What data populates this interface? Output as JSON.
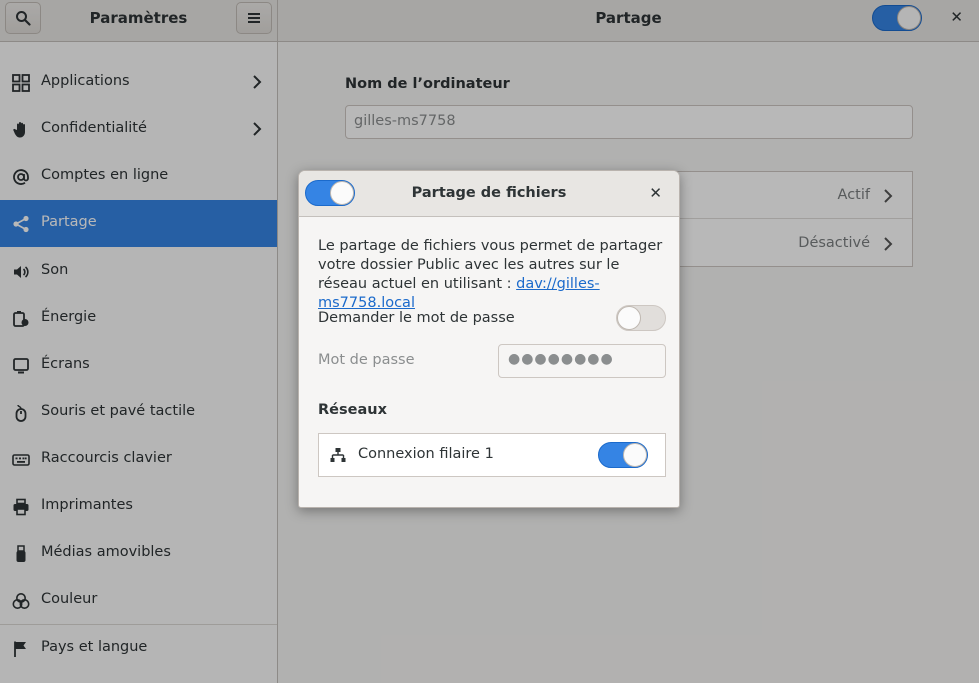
{
  "window": {
    "left_title": "Paramètres",
    "right_title": "Partage",
    "close_glyph": "✕"
  },
  "sidebar": {
    "items": [
      {
        "label": "Applications",
        "icon": "applications-icon",
        "chevron": true
      },
      {
        "label": "Confidentialité",
        "icon": "hand-icon",
        "chevron": true
      },
      {
        "label": "Comptes en ligne",
        "icon": "at-icon",
        "chevron": false
      },
      {
        "label": "Partage",
        "icon": "share-icon",
        "chevron": false,
        "selected": true
      },
      {
        "label": "Son",
        "icon": "speaker-icon",
        "chevron": false
      },
      {
        "label": "Énergie",
        "icon": "power-icon",
        "chevron": false
      },
      {
        "label": "Écrans",
        "icon": "display-icon",
        "chevron": false
      },
      {
        "label": "Souris et pavé tactile",
        "icon": "mouse-icon",
        "chevron": false
      },
      {
        "label": "Raccourcis clavier",
        "icon": "keyboard-icon",
        "chevron": false
      },
      {
        "label": "Imprimantes",
        "icon": "printer-icon",
        "chevron": false
      },
      {
        "label": "Médias amovibles",
        "icon": "usb-icon",
        "chevron": false
      },
      {
        "label": "Couleur",
        "icon": "color-icon",
        "chevron": false
      },
      {
        "label": "Pays et langue",
        "icon": "flag-icon",
        "chevron": false
      }
    ]
  },
  "main": {
    "computer_name_label": "Nom de l’ordinateur",
    "computer_name_value": "gilles-ms7758",
    "rows": [
      {
        "status": "Actif"
      },
      {
        "status": "Désactivé"
      }
    ],
    "sharing_switch_on": true
  },
  "dialog": {
    "title": "Partage de fichiers",
    "switch_on": true,
    "description": "Le partage de fichiers vous permet de partager votre dossier Public avec les autres sur le réseau actuel en utilisant : ",
    "link": "dav://gilles-ms7758.local",
    "require_password_label": "Demander le mot de passe",
    "require_password_on": false,
    "password_label": "Mot de passe",
    "password_value": "●●●●●●●●",
    "networks_title": "Réseaux",
    "network_name": "Connexion filaire 1",
    "network_on": true
  },
  "colors": {
    "accent": "#3584e4",
    "sidebar_bg": "#fbfbfb",
    "header_bg": "#e8e6e3"
  }
}
